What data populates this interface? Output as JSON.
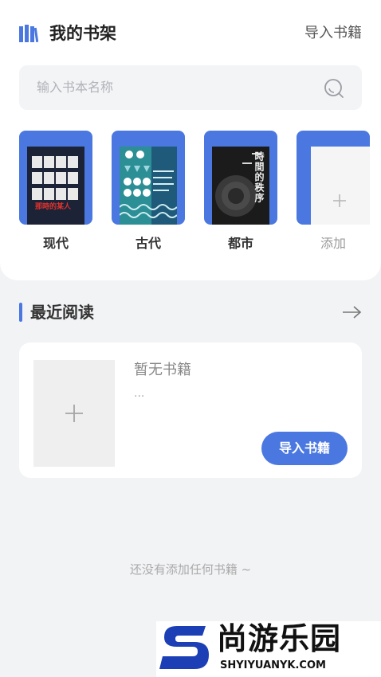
{
  "header": {
    "title": "我的书架",
    "import_label": "导入书籍"
  },
  "search": {
    "placeholder": "输入书本名称"
  },
  "shelf": {
    "categories": [
      {
        "label": "现代",
        "cover_title": "那時的某人"
      },
      {
        "label": "古代"
      },
      {
        "label": "都市",
        "cover_title": "時間的秩序"
      },
      {
        "label": "添加"
      }
    ]
  },
  "recent": {
    "title": "最近阅读",
    "empty_title": "暂无书籍",
    "ellipsis": "...",
    "import_button": "导入书籍"
  },
  "empty_hint": "还没有添加任何书籍 ~",
  "watermark": {
    "brand": "尚游乐园",
    "domain": "SHYIYUANYK.COM"
  },
  "colors": {
    "accent": "#4a78e0",
    "background": "#f2f3f5"
  }
}
